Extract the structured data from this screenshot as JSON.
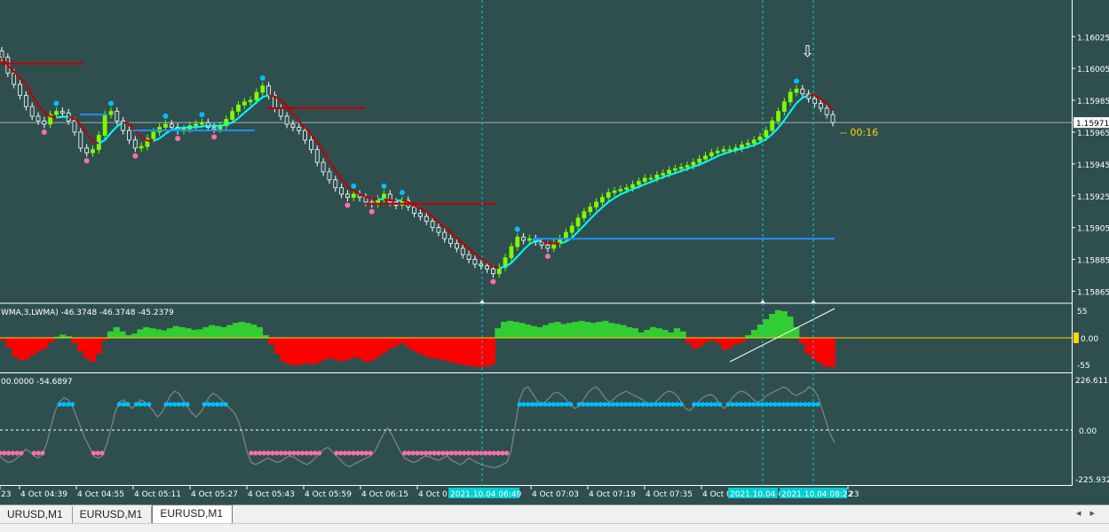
{
  "colors": {
    "background": "#2f4f4f",
    "grid_divider": "#ffffff",
    "bull_candle": "#7cfc00",
    "bear_candle": "#ffffff",
    "ma_line": "#00ffff",
    "trend_red": "#c00000",
    "level_blue": "#1e90ff",
    "dot_up": "#00bfff",
    "dot_down": "#ff6fa8",
    "hist_pos": "#32cd32",
    "hist_neg": "#ff0000",
    "zero_line_yellow": "#ffd700",
    "vline": "#00ced1",
    "osc_line": "#808080"
  },
  "chart_data": {
    "type": "line",
    "symbol": "EURUSD,M1",
    "price_axis_ticks": [
      "1.16025",
      "1.16005",
      "1.15985",
      "1.15965",
      "1.15945",
      "1.15925",
      "1.15905",
      "1.15885",
      "1.15865"
    ],
    "current_price_label": "1.15971",
    "countdown_label": "00:16",
    "time_axis_ticks": [
      "23",
      "4 Oct 04:39",
      "4 Oct 04:55",
      "4 Oct 05:11",
      "4 Oct 05:27",
      "4 Oct 05:43",
      "4 Oct 05:59",
      "4 Oct 06:15",
      "4 Oct 0",
      "4 Oct 07:03",
      "4 Oct 07:19",
      "4 Oct 07:35",
      "4 Oct 0",
      "23"
    ],
    "highlight_time_labels": [
      "2021.10.04 06:49",
      "2021.10.04 0",
      "2021.10.04 08:22"
    ],
    "close_series": [
      1.16012,
      1.16002,
      1.15995,
      1.15988,
      1.15981,
      1.15975,
      1.15972,
      1.1597,
      1.15976,
      1.15978,
      1.15977,
      1.15972,
      1.15965,
      1.15955,
      1.15952,
      1.15954,
      1.15963,
      1.15976,
      1.15978,
      1.15972,
      1.15966,
      1.1596,
      1.15955,
      1.15956,
      1.15961,
      1.15965,
      1.15968,
      1.1597,
      1.15968,
      1.15966,
      1.15967,
      1.15969,
      1.1597,
      1.15971,
      1.15968,
      1.15967,
      1.15969,
      1.15973,
      1.15978,
      1.15982,
      1.15984,
      1.15985,
      1.1599,
      1.15994,
      1.15988,
      1.1598,
      1.15975,
      1.1597,
      1.15968,
      1.15966,
      1.1596,
      1.15954,
      1.15946,
      1.1594,
      1.15935,
      1.1593,
      1.15926,
      1.15924,
      1.15926,
      1.15924,
      1.15921,
      1.1592,
      1.15923,
      1.15926,
      1.15921,
      1.15919,
      1.15922,
      1.15918,
      1.15914,
      1.15912,
      1.15909,
      1.15905,
      1.15902,
      1.15898,
      1.15895,
      1.15892,
      1.15888,
      1.15885,
      1.15882,
      1.15881,
      1.15879,
      1.15876,
      1.1588,
      1.15886,
      1.15893,
      1.15899,
      1.15897,
      1.15898,
      1.15896,
      1.15894,
      1.15892,
      1.15895,
      1.15898,
      1.15902,
      1.15906,
      1.15911,
      1.15915,
      1.15918,
      1.15921,
      1.15924,
      1.15927,
      1.15928,
      1.15929,
      1.1593,
      1.15932,
      1.15934,
      1.15936,
      1.15936,
      1.15938,
      1.15939,
      1.15941,
      1.15942,
      1.15943,
      1.15944,
      1.15946,
      1.15948,
      1.1595,
      1.15952,
      1.15953,
      1.15954,
      1.15954,
      1.15955,
      1.15957,
      1.15958,
      1.1596,
      1.15962,
      1.15966,
      1.15972,
      1.15978,
      1.15984,
      1.1599,
      1.15992,
      1.15989,
      1.15986,
      1.15983,
      1.1598,
      1.15976,
      1.15971
    ],
    "osc_series": [
      -4,
      -18,
      -35,
      -42,
      -40,
      -32,
      -25,
      -20,
      -8,
      2,
      6,
      3,
      -10,
      -25,
      -38,
      -45,
      -30,
      -5,
      12,
      20,
      12,
      5,
      8,
      16,
      20,
      18,
      16,
      14,
      18,
      22,
      20,
      18,
      15,
      16,
      20,
      24,
      22,
      20,
      24,
      28,
      30,
      28,
      25,
      20,
      5,
      -12,
      -30,
      -45,
      -50,
      -52,
      -50,
      -48,
      -50,
      -46,
      -40,
      -38,
      -42,
      -44,
      -40,
      -36,
      -40,
      -45,
      -42,
      -35,
      -28,
      -20,
      -15,
      -10,
      -18,
      -25,
      -30,
      -35,
      -38,
      -40,
      -42,
      -45,
      -48,
      -50,
      -52,
      -54,
      -55,
      -54,
      -50,
      18,
      30,
      32,
      30,
      28,
      25,
      22,
      20,
      24,
      28,
      30,
      26,
      28,
      30,
      32,
      30,
      28,
      30,
      32,
      28,
      26,
      24,
      20,
      18,
      10,
      15,
      20,
      18,
      15,
      10,
      18,
      12,
      -10,
      -20,
      -15,
      -8,
      -5,
      -10,
      -22,
      -18,
      -12,
      -8,
      5,
      15,
      25,
      35,
      45,
      52,
      50,
      40,
      20,
      -10,
      -30,
      -40,
      -46,
      -54,
      -55
    ],
    "osc_labels": "WMA,3,LWMA) -46.3748 -46.3748 -45.2379",
    "osc_ticks": [
      "55",
      "0.00",
      "-55"
    ],
    "osc2_labels": "00.0000 -54.6897",
    "osc2_ticks": [
      "226.6117",
      "0.00",
      "-225.932"
    ],
    "osc2_series": [
      -120,
      -140,
      -150,
      -145,
      -130,
      -110,
      -90,
      -100,
      -120,
      -130,
      -110,
      -60,
      20,
      90,
      130,
      150,
      140,
      110,
      60,
      10,
      -40,
      -80,
      -120,
      -130,
      -120,
      -70,
      0,
      80,
      130,
      140,
      120,
      100,
      120,
      140,
      130,
      110,
      90,
      60,
      80,
      120,
      160,
      180,
      170,
      140,
      110,
      80,
      60,
      80,
      110,
      150,
      170,
      160,
      140,
      120,
      100,
      80,
      40,
      -20,
      -100,
      -150,
      -160,
      -150,
      -140,
      -130,
      -140,
      -150,
      -145,
      -130,
      -120,
      -125,
      -140,
      -150,
      -160,
      -150,
      -130,
      -110,
      -90,
      -80,
      -100,
      -120,
      -140,
      -160,
      -170,
      -160,
      -150,
      -140,
      -130,
      -120,
      -100,
      -60,
      -20,
      10,
      -20,
      -60,
      -100,
      -130,
      -140,
      -150,
      -145,
      -130,
      -120,
      -125,
      -135,
      -140,
      -130,
      -120,
      -140,
      -150,
      -160,
      -150,
      -130,
      -140,
      -150,
      -160,
      -165,
      -170,
      -175,
      -170,
      -160,
      -150,
      -100,
      20,
      140,
      190,
      200,
      170,
      140,
      120,
      130,
      150,
      170,
      175,
      160,
      140,
      120,
      100,
      110,
      140,
      170,
      190,
      200,
      180,
      150,
      130,
      140,
      160,
      170,
      180,
      170,
      160,
      150,
      140,
      120,
      110,
      130,
      150,
      170,
      180,
      175,
      160,
      130,
      100,
      90,
      110,
      130,
      150,
      160,
      165,
      150,
      120,
      100,
      120,
      150,
      170,
      180,
      175,
      160,
      140,
      130,
      140,
      160,
      170,
      180,
      190,
      200,
      190,
      170,
      160,
      170,
      180,
      200,
      190,
      160,
      100,
      40,
      -20,
      -60
    ]
  },
  "tabs": [
    {
      "label": "URUSD,M1"
    },
    {
      "label": "EURUSD,M1"
    },
    {
      "label": "EURUSD,M1"
    }
  ],
  "arrow_marker": "⇩"
}
